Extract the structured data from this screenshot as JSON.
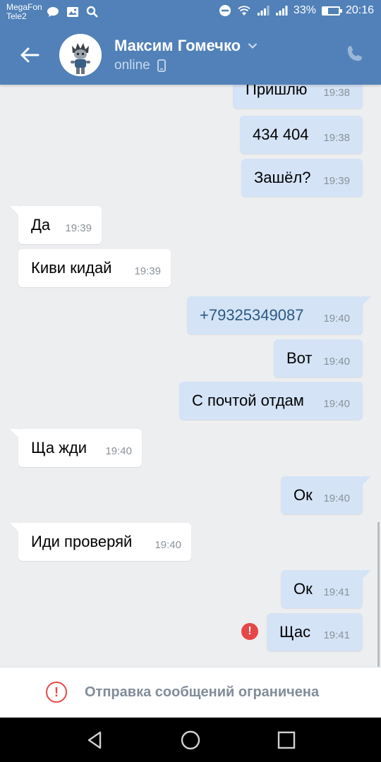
{
  "status_bar": {
    "carrier1": "MegaFon",
    "carrier2": "Tele2",
    "battery": "33%",
    "time": "20:16",
    "battery_level": 0.33
  },
  "header": {
    "name": "Максим Гомечко",
    "status": "online"
  },
  "messages": [
    {
      "dir": "out",
      "text": "Пришлю",
      "time": "19:38"
    },
    {
      "dir": "out",
      "text": "434 404",
      "time": "19:38"
    },
    {
      "dir": "out",
      "text": "Зашёл?",
      "time": "19:39"
    },
    {
      "dir": "in",
      "text": "Да",
      "time": "19:39"
    },
    {
      "dir": "in",
      "text": "Киви кидай",
      "time": "19:39"
    },
    {
      "dir": "out",
      "text": "+79325349087",
      "time": "19:40",
      "link": true
    },
    {
      "dir": "out",
      "text": "Вот",
      "time": "19:40"
    },
    {
      "dir": "out",
      "text": "С почтой отдам",
      "time": "19:40"
    },
    {
      "dir": "in",
      "text": "Ща жди",
      "time": "19:40"
    },
    {
      "dir": "out",
      "text": "Ок",
      "time": "19:40"
    },
    {
      "dir": "in",
      "text": "Иди проверяй",
      "time": "19:40"
    },
    {
      "dir": "out",
      "text": "Ок",
      "time": "19:41"
    },
    {
      "dir": "out",
      "text": "Щас",
      "time": "19:41",
      "failed": true
    }
  ],
  "restricted": {
    "text": "Отправка сообщений ограничена"
  },
  "colors": {
    "header_bg": "#5181b8",
    "chat_bg": "#edeef0",
    "outgoing_bubble": "#d4e3f6",
    "incoming_bubble": "#ffffff",
    "error": "#e64646"
  }
}
